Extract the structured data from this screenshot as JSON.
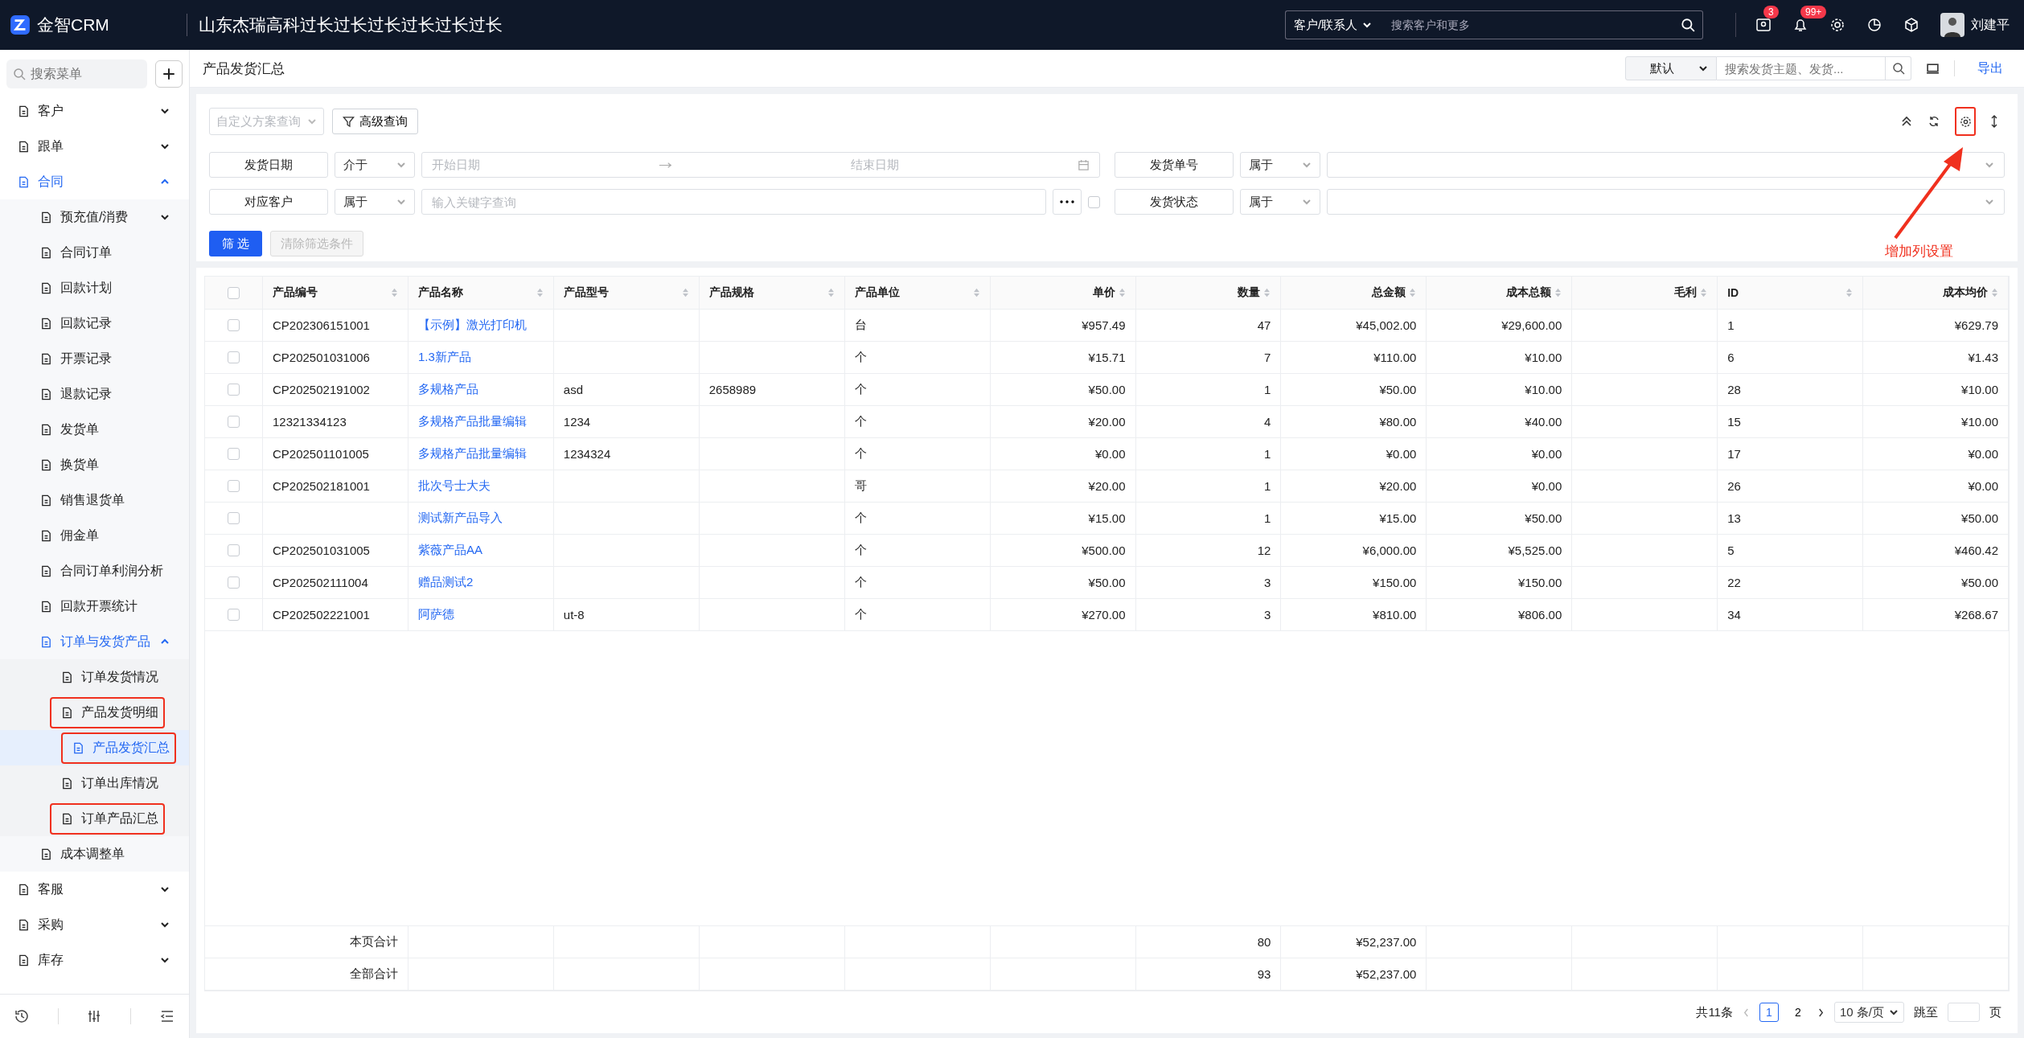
{
  "topbar": {
    "logo": "金智CRM",
    "company": "山东杰瑞高科过长过长过长过长过长过长",
    "search_scope": "客户/联系人",
    "search_placeholder": "搜索客户和更多",
    "message_badge": "3",
    "notice_badge": "99+",
    "user": "刘建平"
  },
  "sidebar": {
    "search_placeholder": "搜索菜单",
    "items": [
      {
        "label": "客户",
        "expanded": false,
        "selected": false
      },
      {
        "label": "跟单",
        "expanded": false,
        "selected": false
      },
      {
        "label": "合同",
        "expanded": true,
        "selected": false,
        "children": [
          {
            "label": "预充值/消费",
            "expanded": false,
            "selected": false
          },
          {
            "label": "合同订单",
            "selected": false
          },
          {
            "label": "回款计划",
            "selected": false
          },
          {
            "label": "回款记录",
            "selected": false
          },
          {
            "label": "开票记录",
            "selected": false
          },
          {
            "label": "退款记录",
            "selected": false
          },
          {
            "label": "发货单",
            "selected": false
          },
          {
            "label": "换货单",
            "selected": false
          },
          {
            "label": "销售退货单",
            "selected": false
          },
          {
            "label": "佣金单",
            "selected": false
          },
          {
            "label": "合同订单利润分析",
            "selected": false
          },
          {
            "label": "回款开票统计",
            "selected": false
          },
          {
            "label": "订单与发货产品",
            "expanded": true,
            "selected": false,
            "children": [
              {
                "label": "订单发货情况",
                "selected": false,
                "annotated": false
              },
              {
                "label": "产品发货明细",
                "selected": false,
                "annotated": true
              },
              {
                "label": "产品发货汇总",
                "selected": true,
                "annotated": true
              },
              {
                "label": "订单出库情况",
                "selected": false,
                "annotated": false
              },
              {
                "label": "订单产品汇总",
                "selected": false,
                "annotated": true
              }
            ]
          },
          {
            "label": "成本调整单",
            "selected": false
          }
        ]
      },
      {
        "label": "客服",
        "expanded": false,
        "selected": false
      },
      {
        "label": "采购",
        "expanded": false,
        "selected": false
      },
      {
        "label": "库存",
        "expanded": false,
        "selected": false
      }
    ]
  },
  "page_header": {
    "title": "产品发货汇总",
    "view": "默认",
    "search_placeholder": "搜索发货主题、发货...",
    "export": "导出"
  },
  "filters": {
    "scheme_placeholder": "自定义方案查询",
    "advanced": "高级查询",
    "gear_annotated": true,
    "rows": [
      [
        {
          "field": "发货日期",
          "operator": "介于",
          "kind": "daterange",
          "start_placeholder": "开始日期",
          "end_placeholder": "结束日期"
        },
        {
          "field": "发货单号",
          "operator": "属于",
          "kind": "select"
        }
      ],
      [
        {
          "field": "对应客户",
          "operator": "属于",
          "kind": "text",
          "placeholder": "输入关键字查询",
          "checked": false
        },
        {
          "field": "发货状态",
          "operator": "属于",
          "kind": "select"
        }
      ]
    ],
    "apply": "筛 选",
    "clear": {
      "label": "清除筛选条件",
      "disabled": true
    },
    "annotation": "增加列设置"
  },
  "table": {
    "header_checked": false,
    "columns": [
      {
        "label": "产品编号"
      },
      {
        "label": "产品名称"
      },
      {
        "label": "产品型号"
      },
      {
        "label": "产品规格"
      },
      {
        "label": "产品单位"
      },
      {
        "label": "单价"
      },
      {
        "label": "数量"
      },
      {
        "label": "总金额"
      },
      {
        "label": "成本总额"
      },
      {
        "label": "毛利"
      },
      {
        "label": "ID"
      },
      {
        "label": "成本均价"
      }
    ],
    "rows": [
      {
        "checked": false,
        "code": "CP202306151001",
        "name": "【示例】激光打印机",
        "unit": "台",
        "price": "¥957.49",
        "qty": "47",
        "amount": "¥45,002.00",
        "cost": "¥29,600.00",
        "id": "1",
        "avg": "¥629.79"
      },
      {
        "checked": false,
        "code": "CP202501031006",
        "name": "1.3新产品",
        "unit": "个",
        "price": "¥15.71",
        "qty": "7",
        "amount": "¥110.00",
        "cost": "¥10.00",
        "id": "6",
        "avg": "¥1.43"
      },
      {
        "checked": false,
        "code": "CP202502191002",
        "name": "多规格产品",
        "model": "asd",
        "spec": "2658989",
        "unit": "个",
        "price": "¥50.00",
        "qty": "1",
        "amount": "¥50.00",
        "cost": "¥10.00",
        "id": "28",
        "avg": "¥10.00"
      },
      {
        "checked": false,
        "code": "12321334123",
        "name": "多规格产品批量编辑",
        "model": "1234",
        "unit": "个",
        "price": "¥20.00",
        "qty": "4",
        "amount": "¥80.00",
        "cost": "¥40.00",
        "id": "15",
        "avg": "¥10.00"
      },
      {
        "checked": false,
        "code": "CP202501101005",
        "name": "多规格产品批量编辑",
        "model": "1234324",
        "unit": "个",
        "price": "¥0.00",
        "qty": "1",
        "amount": "¥0.00",
        "cost": "¥0.00",
        "id": "17",
        "avg": "¥0.00"
      },
      {
        "checked": false,
        "code": "CP202502181001",
        "name": "批次号士大夫",
        "unit": "哥",
        "price": "¥20.00",
        "qty": "1",
        "amount": "¥20.00",
        "cost": "¥0.00",
        "id": "26",
        "avg": "¥0.00"
      },
      {
        "checked": false,
        "name": "测试新产品导入",
        "unit": "个",
        "price": "¥15.00",
        "qty": "1",
        "amount": "¥15.00",
        "cost": "¥50.00",
        "id": "13",
        "avg": "¥50.00"
      },
      {
        "checked": false,
        "code": "CP202501031005",
        "name": "紫薇产品AA",
        "unit": "个",
        "price": "¥500.00",
        "qty": "12",
        "amount": "¥6,000.00",
        "cost": "¥5,525.00",
        "id": "5",
        "avg": "¥460.42"
      },
      {
        "checked": false,
        "code": "CP202502111004",
        "name": "赠品测试2",
        "unit": "个",
        "price": "¥50.00",
        "qty": "3",
        "amount": "¥150.00",
        "cost": "¥150.00",
        "id": "22",
        "avg": "¥50.00"
      },
      {
        "checked": false,
        "code": "CP202502221001",
        "name": "阿萨德",
        "model": "ut-8",
        "unit": "个",
        "price": "¥270.00",
        "qty": "3",
        "amount": "¥810.00",
        "cost": "¥806.00",
        "id": "34",
        "avg": "¥268.67"
      }
    ],
    "summary": [
      {
        "label": "本页合计",
        "qty": "80",
        "amount": "¥52,237.00"
      },
      {
        "label": "全部合计",
        "qty": "93",
        "amount": "¥52,237.00"
      }
    ]
  },
  "pagination": {
    "total": "共11条",
    "pages": [
      {
        "label": "1",
        "selected": true
      },
      {
        "label": "2",
        "selected": false
      }
    ],
    "page_size": "10 条/页",
    "jump_label": "跳至",
    "page_suffix": "页"
  }
}
